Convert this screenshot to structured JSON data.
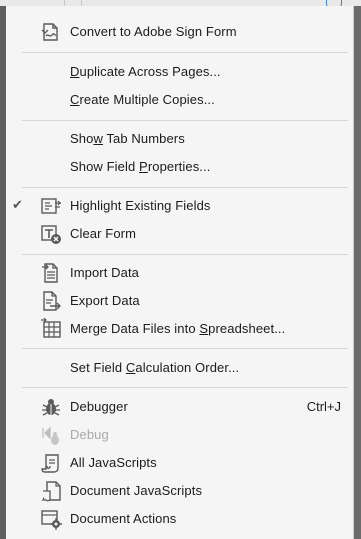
{
  "menu": {
    "convert_sign_form": "Convert to Adobe Sign Form",
    "duplicate_across_pages": {
      "pre": "",
      "u": "D",
      "post": "uplicate Across Pages..."
    },
    "create_multiple_copies": {
      "pre": "",
      "u": "C",
      "post": "reate Multiple Copies..."
    },
    "show_tab_numbers": {
      "pre": "Sho",
      "u": "w",
      "post": " Tab Numbers"
    },
    "show_field_properties": {
      "pre": "Show Field ",
      "u": "P",
      "post": "roperties..."
    },
    "highlight_existing_fields": "Highlight Existing Fields",
    "highlight_checked_mark": "✔",
    "clear_form": "Clear Form",
    "import_data": "Import Data",
    "export_data": "Export Data",
    "merge_data_files": {
      "pre": "Merge Data Files into ",
      "u": "S",
      "post": "preadsheet..."
    },
    "set_field_calc_order": {
      "pre": "Set Field ",
      "u": "C",
      "post": "alculation Order..."
    },
    "debugger": "Debugger",
    "debugger_shortcut": "Ctrl+J",
    "debug": "Debug",
    "all_javascripts": "All JavaScripts",
    "document_javascripts": "Document JavaScripts",
    "document_actions": "Document Actions"
  },
  "colors": {
    "menu_bg": "#f5f5f5",
    "text": "#1b1b1b",
    "disabled_text": "#a9a9a9",
    "icon": "#5a5a5a",
    "separator": "#d6d6d6"
  }
}
